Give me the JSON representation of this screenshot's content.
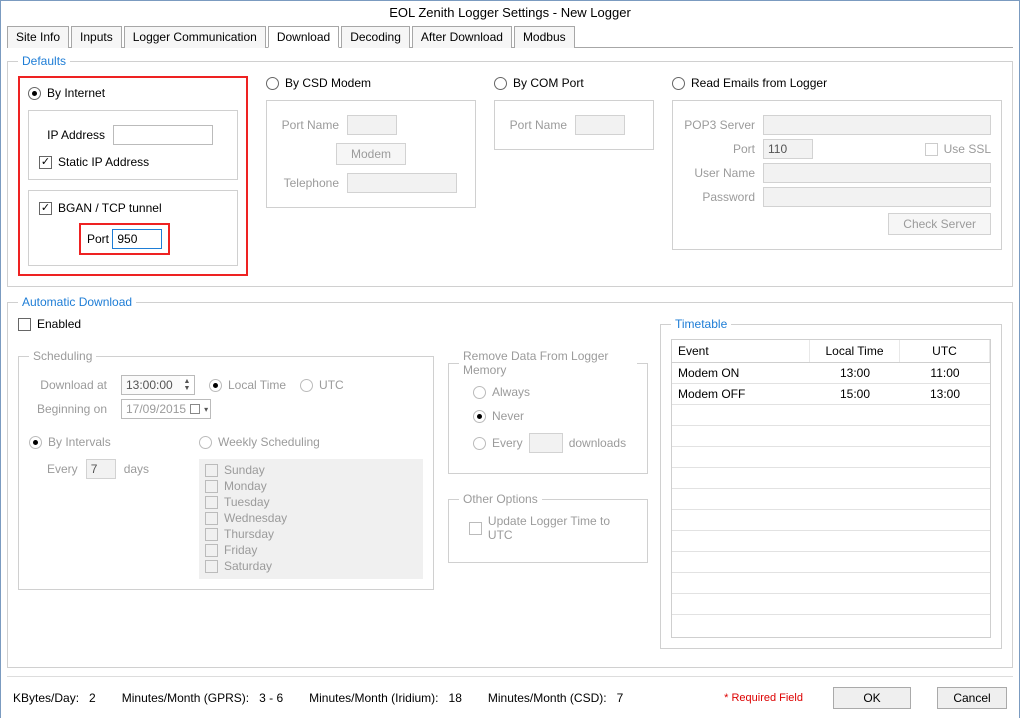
{
  "title": "EOL Zenith Logger Settings - New Logger",
  "tabs": [
    "Site Info",
    "Inputs",
    "Logger Communication",
    "Download",
    "Decoding",
    "After Download",
    "Modbus"
  ],
  "active_tab": "Download",
  "defaults": {
    "legend": "Defaults",
    "internet": {
      "label": "By Internet",
      "ip_label": "IP Address",
      "static_label": "Static IP Address",
      "bgan_label": "BGAN / TCP tunnel",
      "port_label": "Port",
      "port_value": "950"
    },
    "csd": {
      "label": "By CSD Modem",
      "portname": "Port Name",
      "modem_btn": "Modem",
      "tel": "Telephone"
    },
    "com": {
      "label": "By COM Port",
      "portname": "Port Name"
    },
    "emails": {
      "label": "Read Emails from Logger",
      "pop3": "POP3 Server",
      "port_l": "Port",
      "port_v": "110",
      "ssl": "Use SSL",
      "user": "User Name",
      "pass": "Password",
      "check": "Check Server"
    }
  },
  "auto": {
    "legend": "Automatic Download",
    "enabled": "Enabled",
    "sched": {
      "legend": "Scheduling",
      "dl_at": "Download at",
      "dl_at_v": "13:00:00",
      "local": "Local Time",
      "utc": "UTC",
      "beg": "Beginning on",
      "beg_v": "17/09/2015",
      "by_int": "By Intervals",
      "every": "Every",
      "every_v": "7",
      "days_l": "days",
      "weekly": "Weekly Scheduling",
      "days": [
        "Sunday",
        "Monday",
        "Tuesday",
        "Wednesday",
        "Thursday",
        "Friday",
        "Saturday"
      ]
    },
    "remove": {
      "legend": "Remove Data From Logger Memory",
      "always": "Always",
      "never": "Never",
      "every": "Every",
      "dl": "downloads"
    },
    "other": {
      "legend": "Other Options",
      "upd": "Update Logger Time to UTC"
    },
    "tt": {
      "legend": "Timetable",
      "cols": [
        "Event",
        "Local Time",
        "UTC"
      ],
      "rows": [
        {
          "e": "Modem ON",
          "lt": "13:00",
          "utc": "11:00"
        },
        {
          "e": "Modem OFF",
          "lt": "15:00",
          "utc": "13:00"
        }
      ]
    }
  },
  "footer": {
    "kb": "KBytes/Day:",
    "kb_v": "2",
    "gprs": "Minutes/Month (GPRS):",
    "gprs_v": "3 - 6",
    "irid": "Minutes/Month (Iridium):",
    "irid_v": "18",
    "csd": "Minutes/Month (CSD):",
    "csd_v": "7",
    "req": "Required Field",
    "ok": "OK",
    "cancel": "Cancel"
  }
}
